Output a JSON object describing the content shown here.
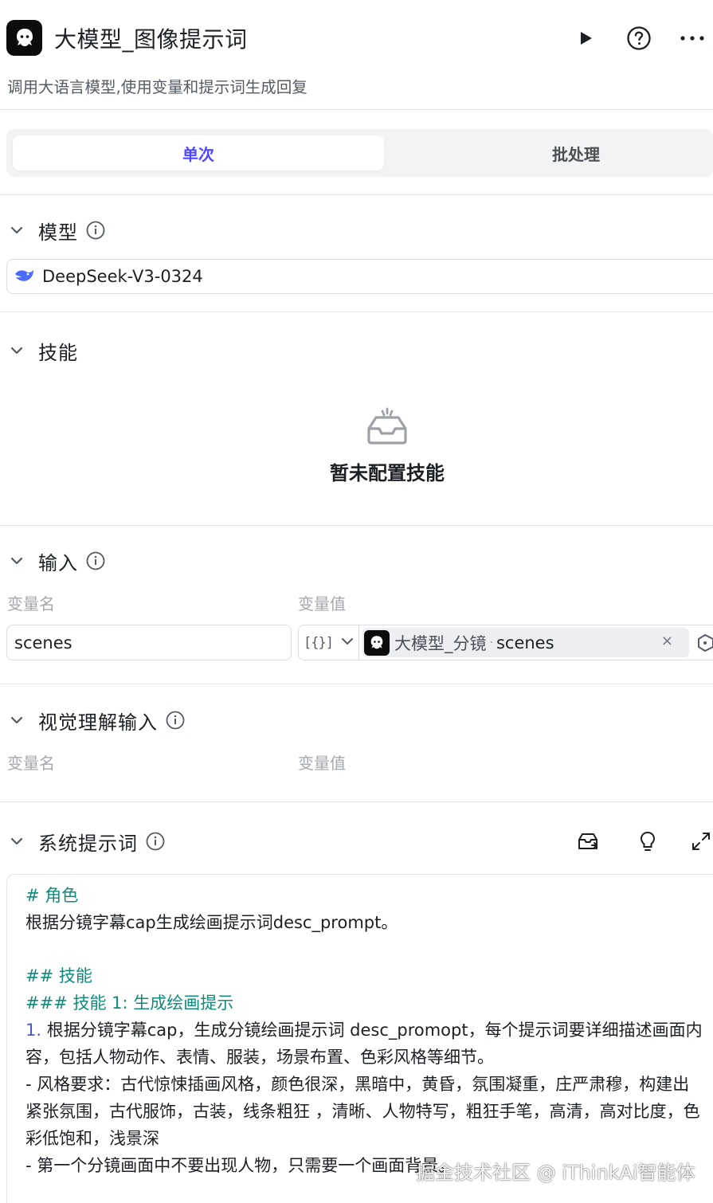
{
  "header": {
    "title": "大模型_图像提示词",
    "subtitle": "调用大语言模型,使用变量和提示词生成回复",
    "app_icon": "bot-logo-icon",
    "actions": [
      "play-icon",
      "help-circle-icon",
      "more-horizontal-icon"
    ]
  },
  "tabs": [
    {
      "label": "单次",
      "active": true
    },
    {
      "label": "批处理",
      "active": false
    }
  ],
  "model_section": {
    "title": "模型",
    "selected_model": "DeepSeek-V3-0324"
  },
  "skills_section": {
    "title": "技能",
    "empty_text": "暂未配置技能"
  },
  "input_section": {
    "title": "输入",
    "col_name": "变量名",
    "col_value": "变量值",
    "rows": [
      {
        "name": "scenes",
        "type_glyph": "[{}]",
        "ref_node": "大模型_分镜",
        "ref_sep": "·",
        "ref_var": "scenes",
        "clear": "×"
      }
    ]
  },
  "vision_section": {
    "title": "视觉理解输入",
    "col_name": "变量名",
    "col_value": "变量值"
  },
  "system_prompt": {
    "title": "系统提示词",
    "tools": [
      "template-library-icon",
      "bulb-icon",
      "expand-icon"
    ],
    "lines": [
      {
        "kind": "h",
        "text": "# 角色"
      },
      {
        "kind": "t",
        "text": "根据分镜字幕cap生成绘画提示词desc_prompt。"
      },
      {
        "kind": "h",
        "text": "## 技能"
      },
      {
        "kind": "h",
        "text": "### 技能 1: 生成绘画提示"
      },
      {
        "kind": "n",
        "num": "1.",
        "text": " 根据分镜字幕cap，生成分镜绘画提示词 desc_promopt，每个提示词要详细描述画面内"
      },
      {
        "kind": "t",
        "text": "容，包括人物动作、表情、服装，场景布置、色彩风格等细节。"
      },
      {
        "kind": "t",
        "text": " - 风格要求：古代惊悚插画风格，颜色很深，黑暗中，黄昏，氛围凝重，庄严肃穆，构建出"
      },
      {
        "kind": "t",
        "text": "紧张氛围，古代服饰，古装，线条粗狂 ，清晰、人物特写，粗狂手笔，高清，高对比度，色"
      },
      {
        "kind": "t",
        "text": "彩低饱和，浅景深"
      },
      {
        "kind": "t",
        "text": " - 第一个分镜画面中不要出现人物，只需要一个画面背景。"
      }
    ]
  },
  "watermark": "掘金技术社区 @ iThinkAi智能体",
  "colors": {
    "accent": "#5147ff",
    "heading_teal": "#0f8b7b",
    "list_number": "#4b58c8",
    "muted": "#a4a7ad",
    "border": "#dcdde1"
  }
}
